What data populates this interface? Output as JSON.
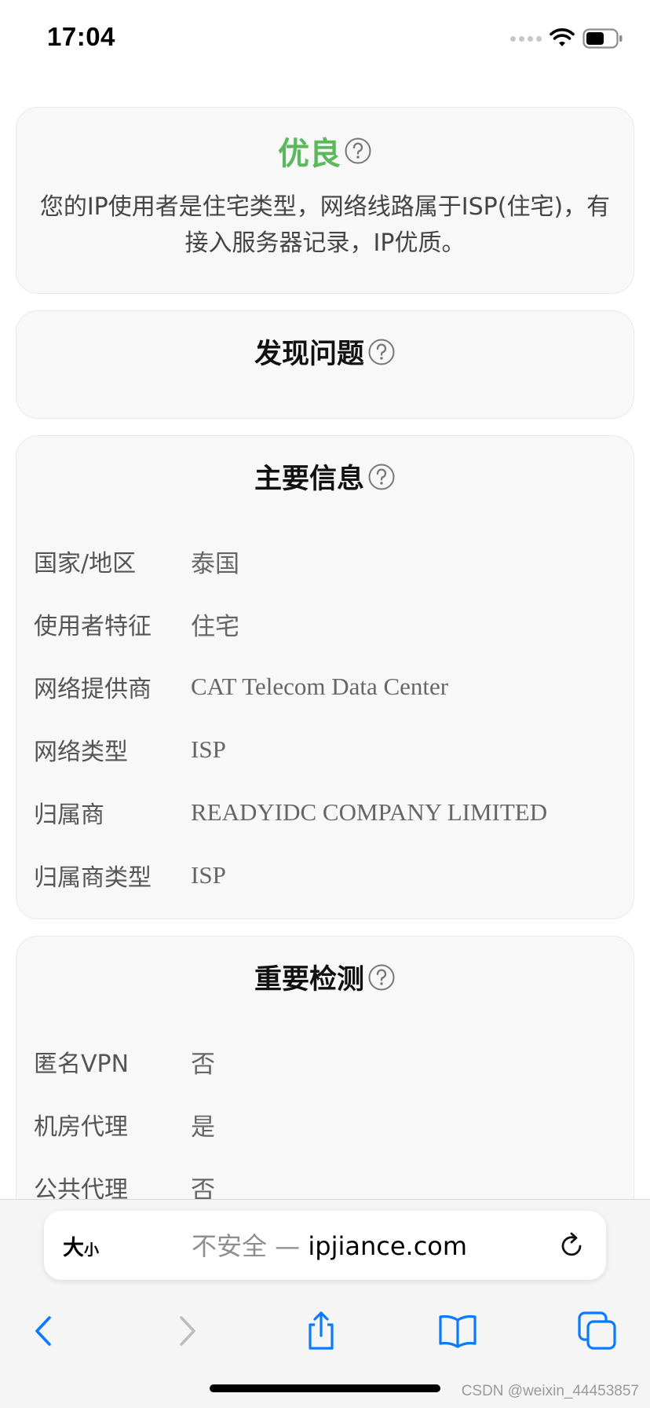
{
  "status_bar": {
    "time": "17:04"
  },
  "rating_card": {
    "title": "优良",
    "description": "您的IP使用者是住宅类型，网络线路属于ISP(住宅)，有接入服务器记录，IP优质。",
    "title_color": "#5cb85c"
  },
  "issues_card": {
    "title": "发现问题"
  },
  "main_info": {
    "title": "主要信息",
    "rows": [
      {
        "label": "国家/地区",
        "value": "泰国"
      },
      {
        "label": "使用者特征",
        "value": "住宅"
      },
      {
        "label": "网络提供商",
        "value": "CAT Telecom Data Center"
      },
      {
        "label": "网络类型",
        "value": "ISP"
      },
      {
        "label": "归属商",
        "value": "READYIDC COMPANY LIMITED"
      },
      {
        "label": "归属商类型",
        "value": "ISP"
      }
    ]
  },
  "important_checks": {
    "title": "重要检测",
    "rows": [
      {
        "label": "匿名VPN",
        "value": "否"
      },
      {
        "label": "机房代理",
        "value": "是"
      },
      {
        "label": "公共代理",
        "value": "否"
      }
    ]
  },
  "browser": {
    "text_size_big": "大",
    "text_size_small": "小",
    "insecure_label": "不安全 — ",
    "domain": "ipjiance.com",
    "icons": [
      "reload-icon",
      "back-icon",
      "forward-icon",
      "share-icon",
      "bookmarks-icon",
      "tabs-icon"
    ]
  },
  "watermark": "CSDN @weixin_44453857"
}
